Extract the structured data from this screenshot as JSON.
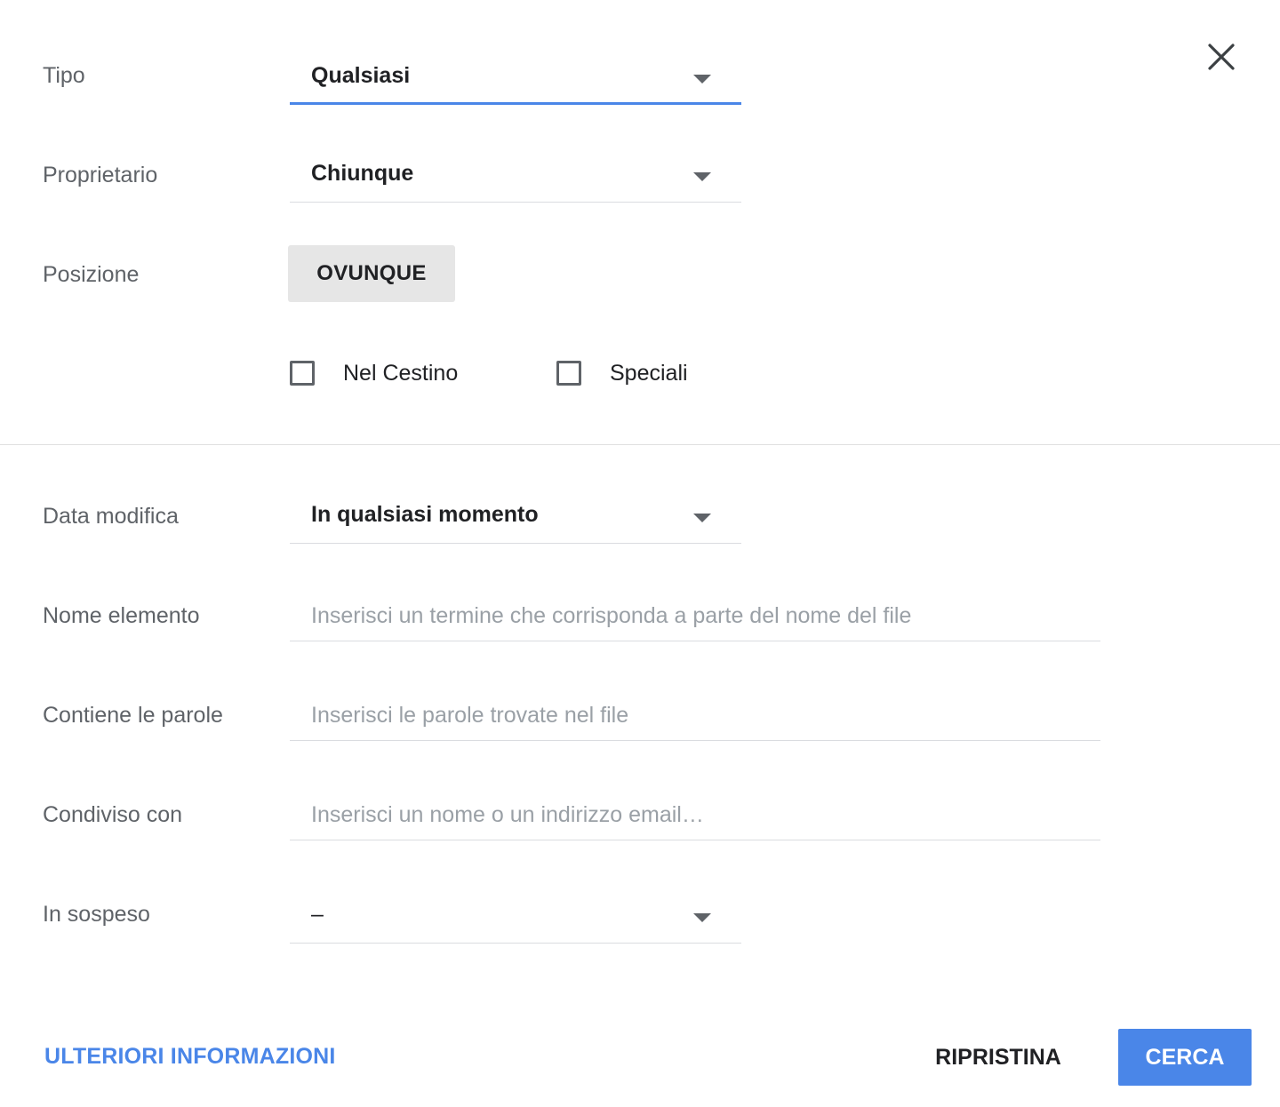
{
  "dialog": {
    "close_icon": "close-icon"
  },
  "rows": {
    "type": {
      "label": "Tipo",
      "value": "Qualsiasi"
    },
    "owner": {
      "label": "Proprietario",
      "value": "Chiunque"
    },
    "location": {
      "label": "Posizione",
      "button_label": "OVUNQUE"
    },
    "checkboxes": {
      "trash": {
        "label": "Nel Cestino",
        "checked": false
      },
      "starred": {
        "label": "Speciali",
        "checked": false
      }
    },
    "date_modified": {
      "label": "Data modifica",
      "value": "In qualsiasi momento"
    },
    "item_name": {
      "label": "Nome elemento",
      "value": "",
      "placeholder": "Inserisci un termine che corrisponda a parte del nome del file"
    },
    "has_words": {
      "label": "Contiene le parole",
      "value": "",
      "placeholder": "Inserisci le parole trovate nel file"
    },
    "shared_with": {
      "label": "Condiviso con",
      "value": "",
      "placeholder": "Inserisci un nome o un indirizzo email…"
    },
    "follow_ups": {
      "label": "In sospeso",
      "value": "–"
    }
  },
  "footer": {
    "learn_more": "ULTERIORI INFORMAZIONI",
    "reset": "RIPRISTINA",
    "search": "CERCA"
  },
  "colors": {
    "accent": "#4a86e8",
    "label": "#5f6368",
    "text": "#202124",
    "placeholder": "#9aa0a6",
    "chip_bg": "#e6e6e6"
  }
}
